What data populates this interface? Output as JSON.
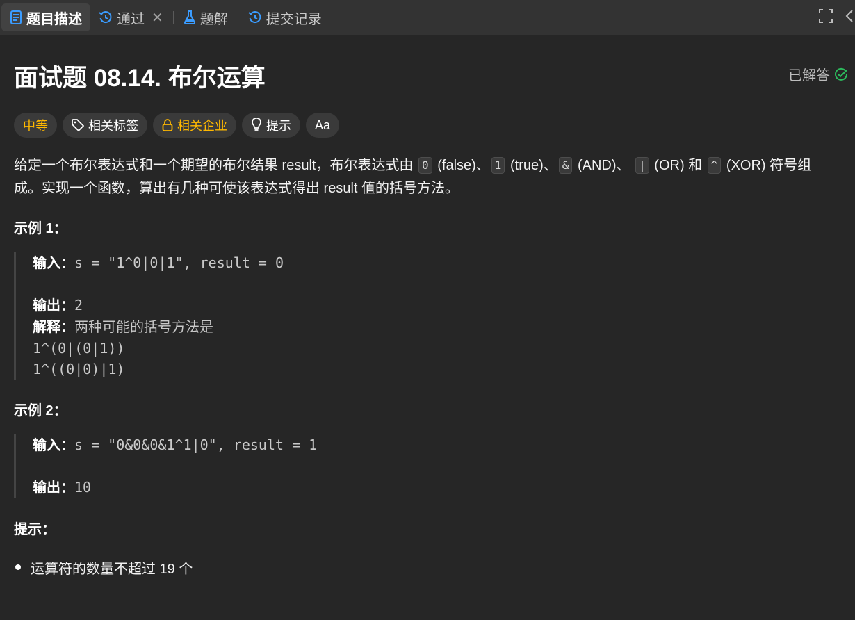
{
  "tabs": {
    "description": "题目描述",
    "accepted": "通过",
    "solutions": "题解",
    "submissions": "提交记录"
  },
  "problem": {
    "title": "面试题 08.14. 布尔运算",
    "status": "已解答",
    "difficulty": "中等",
    "tag_related": "相关标签",
    "tag_company": "相关企业",
    "tag_hint": "提示",
    "font_button": "Aa"
  },
  "description": {
    "p1": "给定一个布尔表达式和一个期望的布尔结果 result，布尔表达式由 ",
    "c0": "0",
    "p2": " (false)、",
    "c1": "1",
    "p3": " (true)、",
    "c2": "&",
    "p4": " (AND)、 ",
    "c3": "|",
    "p5": " (OR) 和 ",
    "c4": "^",
    "p6": " (XOR) 符号组成。实现一个函数，算出有几种可使该表达式得出 result 值的括号方法。"
  },
  "example1": {
    "heading": "示例 1：",
    "input_label": "输入：",
    "input_value": "s = \"1^0|0|1\", result = 0",
    "output_label": "输出：",
    "output_value": "2",
    "explain_label": "解释：",
    "explain_value": "两种可能的括号方法是",
    "line1": "1^(0|(0|1))",
    "line2": "1^((0|0)|1)"
  },
  "example2": {
    "heading": "示例 2：",
    "input_label": "输入：",
    "input_value": "s = \"0&0&0&1^1|0\", result = 1",
    "output_label": "输出：",
    "output_value": "10"
  },
  "tips": {
    "heading": "提示：",
    "item1": "运算符的数量不超过 19 个"
  }
}
